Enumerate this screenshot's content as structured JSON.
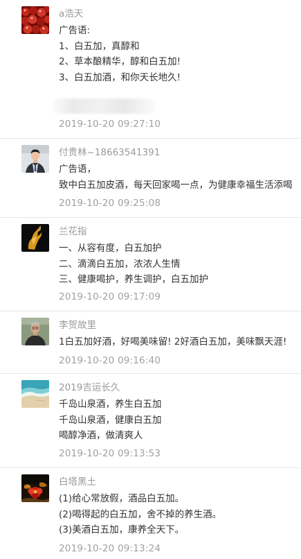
{
  "comments": [
    {
      "name": "a浩天",
      "avatar_icon": "red-berries-photo-icon",
      "lines": [
        "广告语:",
        "1、白五加，真醇和",
        "2、草本酿精华，醇和白五加!",
        "3、白五加酒，和你天长地久!"
      ],
      "time": "2019-10-20 09:27:10"
    },
    {
      "name": "付贵林~18663541391",
      "avatar_icon": "man-in-suit-photo-icon",
      "lines": [
        "广告语，",
        "致中白五加皮酒，每天回家喝一点，为健康幸福生活添喝"
      ],
      "time": "2019-10-20 09:25:08"
    },
    {
      "name": "兰花指",
      "avatar_icon": "golden-hand-gesture-icon",
      "lines": [
        "一、从容有度，白五加护",
        "二、滴滴白五加，浓浓人生情",
        "三、健康喝护，养生调护，白五加护"
      ],
      "time": "2019-10-20 09:17:09"
    },
    {
      "name": "李贺故里",
      "avatar_icon": "elderly-man-photo-icon",
      "lines": [
        "1白五加好酒，好喝美味留! 2好酒白五加，美味飘天涯!"
      ],
      "time": "2019-10-20 09:16:40"
    },
    {
      "name": "2019吉运长久",
      "avatar_icon": "beach-landscape-photo-icon",
      "lines": [
        "千岛山泉酒，养生白五加",
        "千岛山泉酒，健康白五加",
        "喝醇净酒，做清爽人"
      ],
      "time": "2019-10-20 09:13:53"
    },
    {
      "name": "白塔黑土",
      "avatar_icon": "red-flower-photo-icon",
      "lines": [
        "(1)给心常放假，酒品白五加。",
        "(2)喝得起的白五加，舍不掉的养生酒。",
        "(3)美酒白五加，康养全天下。"
      ],
      "time": "2019-10-20 09:13:24"
    }
  ]
}
